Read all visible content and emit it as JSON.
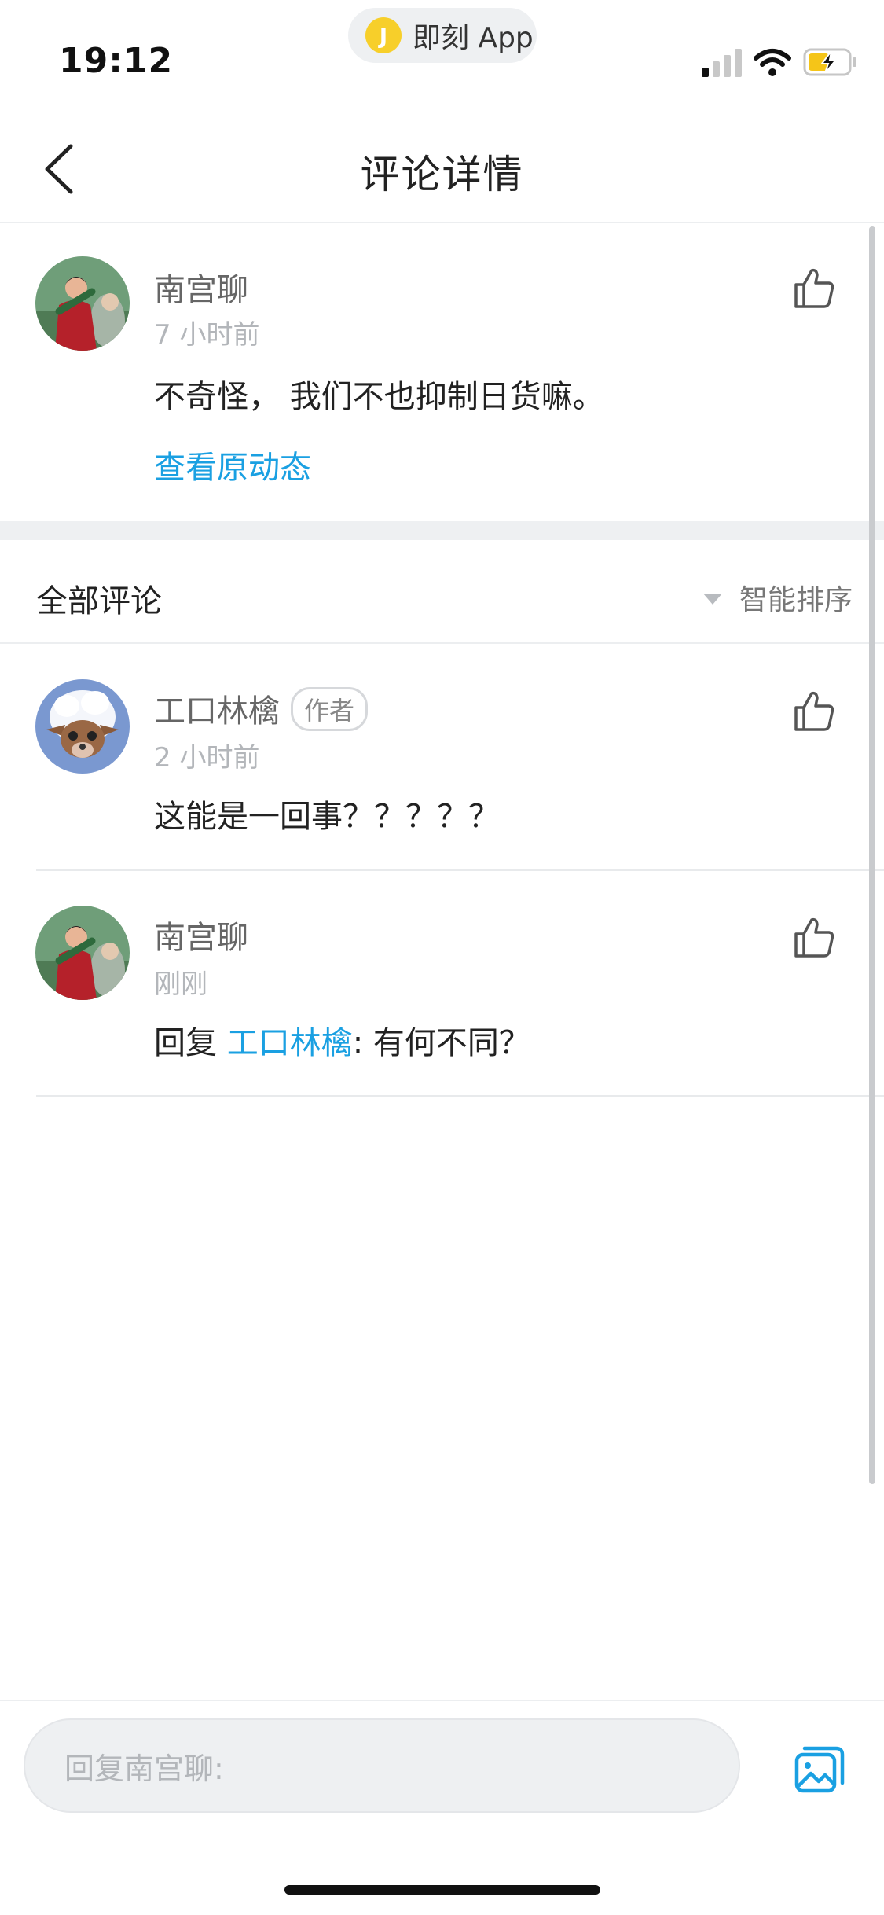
{
  "status_bar": {
    "time": "19:12",
    "app_pill": {
      "logo_glyph": "J",
      "label": "即刻 App",
      "logo_color": "#f7cf2a"
    },
    "battery_color": "#f5c518"
  },
  "nav": {
    "title": "评论详情"
  },
  "original_comment": {
    "user": "南宫聊",
    "time": "7 小时前",
    "text": "不奇怪， 我们不也抑制日货嘛。",
    "view_original": "查看原动态"
  },
  "comments_header": {
    "title": "全部评论",
    "sort_label": "智能排序"
  },
  "comments": [
    {
      "user": "工口林檎",
      "badge": "作者",
      "time": "2 小时前",
      "text": "这能是一回事？？？？？"
    },
    {
      "user": "南宫聊",
      "time": "刚刚",
      "reply_prefix": "回复 ",
      "reply_to": "工口林檎",
      "reply_text": ": 有何不同？"
    }
  ],
  "reply_bar": {
    "placeholder": "回复南宫聊:"
  },
  "colors": {
    "accent": "#1aa0e2",
    "avatar_red": "#b5212a",
    "avatar_sky": "#7a98d0"
  }
}
